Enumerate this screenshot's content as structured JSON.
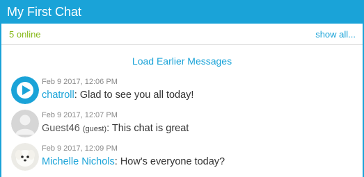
{
  "chat": {
    "title": "My First Chat",
    "online_label": "5 online",
    "show_all_label": "show all...",
    "load_earlier_label": "Load Earlier Messages"
  },
  "messages": [
    {
      "timestamp": "Feb 9 2017, 12:06 PM",
      "author": "chatroll",
      "separator": ": ",
      "text": "Glad to see you all today!",
      "avatar_icon": "chatroll-logo-icon"
    },
    {
      "timestamp": "Feb 9 2017, 12:07 PM",
      "author": "Guest46",
      "guest_tag": "(guest)",
      "separator": ": ",
      "text": "This chat is great",
      "avatar_icon": "default-user-icon"
    },
    {
      "timestamp": "Feb 9 2017, 12:09 PM",
      "author": "Michelle Nichols",
      "separator": ": ",
      "text": "How's everyone today?",
      "avatar_icon": "dog-photo-avatar"
    }
  ],
  "colors": {
    "brand": "#1aa3d8",
    "online": "#86b817",
    "timestamp": "#8a8a8a"
  }
}
